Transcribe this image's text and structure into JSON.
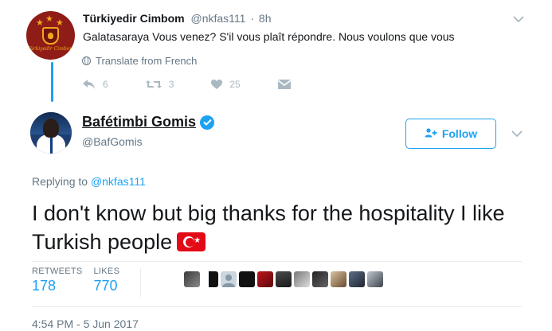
{
  "parent_tweet": {
    "display_name": "Türkiyedir Cimbom",
    "handle": "@nkfas111",
    "time": "8h",
    "text": "Galatasaraya Vous venez? S'il vous plaît répondre. Nous voulons que vous",
    "avatar_caption": "Türkiyedir Cimbom",
    "translate_label": "Translate from French",
    "actions": {
      "reply_count": "6",
      "retweet_count": "3",
      "like_count": "25"
    }
  },
  "main_tweet": {
    "display_name": "Bafétimbi Gomis",
    "handle": "@BafGomis",
    "follow_label": "Follow",
    "replying_prefix": "Replying to",
    "replying_to": "@nkfas111",
    "text": "I don't know but big thanks for the hospitality I like Turkish people",
    "stats": {
      "retweets_label": "RETWEETS",
      "retweets_value": "178",
      "likes_label": "LIKES",
      "likes_value": "770"
    },
    "timestamp": "4:54 PM - 5 Jun 2017"
  },
  "icons": {
    "verified": "verified-badge-icon",
    "follow": "follow-person-plus-icon",
    "chevron": "chevron-down-icon",
    "reply": "reply-arrow-icon",
    "retweet": "retweet-icon",
    "like": "heart-icon",
    "dm": "direct-message-icon",
    "flag": "turkey-flag-emoji"
  },
  "colors": {
    "accent": "#1da1f2",
    "text_primary": "#14171a",
    "text_secondary": "#657786",
    "action_gray": "#aab8c2",
    "divider": "#e6ecf0",
    "flag_red": "#e30a17"
  }
}
